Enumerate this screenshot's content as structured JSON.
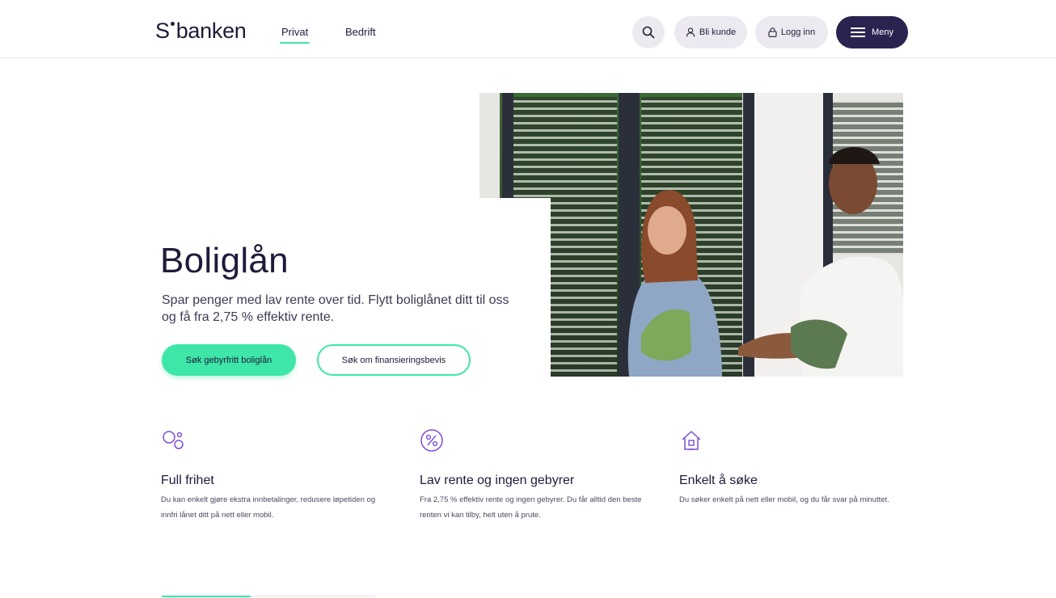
{
  "header": {
    "logo_s": "S",
    "logo_text": "banken",
    "nav": [
      {
        "label": "Privat"
      },
      {
        "label": "Bedrift"
      }
    ],
    "actions": {
      "search_icon": "search-icon",
      "bli_kunde": "Bli kunde",
      "logg_inn": "Logg inn",
      "meny": "Meny"
    }
  },
  "hero": {
    "title": "Boliglån",
    "subtitle": "Spar penger med lav rente over tid. Flytt boliglånet ditt til oss og få fra 2,75 % effektiv rente.",
    "primary_button": "Søk gebyrfritt boliglån",
    "secondary_button": "Søk om finansieringsbevis"
  },
  "features": [
    {
      "icon": "circles-icon",
      "title": "Full frihet",
      "text": "Du kan enkelt gjøre ekstra innbetalinger, redusere løpetiden og innfri lånet ditt på nett eller mobil."
    },
    {
      "icon": "percent-icon",
      "title": "Lav rente og ingen gebyrer",
      "text": "Fra 2,75 % effektiv rente og ingen gebyrer. Du får alltid den beste renten vi kan tilby, helt uten å prute."
    },
    {
      "icon": "house-icon",
      "title": "Enkelt å søke",
      "text": "Du søker enkelt på nett eller mobil, og du får svar på minuttet."
    }
  ],
  "colors": {
    "accent": "#3ee6a8",
    "navy": "#2a2350",
    "icon_purple": "#7b4fd6"
  }
}
